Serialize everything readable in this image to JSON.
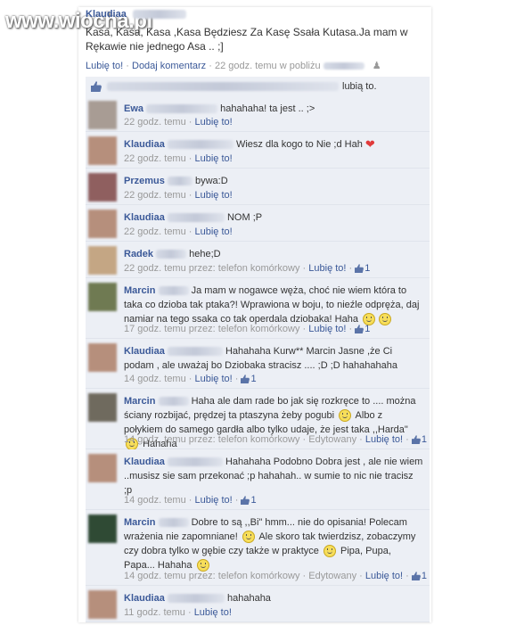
{
  "watermark": "www.wiocha.pl",
  "post": {
    "author": "Klaudiaa",
    "text": "Kasa, Kasa, Kasa ,Kasa Będziesz Za Kasę Ssała Kutasa.Ja mam w Rękawie nie jednego Asa .. ;]",
    "meta_like": "Lubię to!",
    "meta_comment": "Dodaj komentarz",
    "meta_time": "22 godz. temu w pobliżu",
    "likes_text": "lubią to."
  },
  "comments": [
    {
      "author": "Ewa",
      "text": "hahahaha! ta jest .. ;>",
      "time": "22 godz. temu",
      "like": "Lubię to!"
    },
    {
      "author": "Klaudiaa",
      "text": "Wiesz dla kogo to Nie ;d Hah",
      "time": "22 godz. temu",
      "like": "Lubię to!"
    },
    {
      "author": "Przemus",
      "text": "bywa:D",
      "time": "22 godz. temu",
      "like": "Lubię to!"
    },
    {
      "author": "Klaudiaa",
      "text": "NOM ;P",
      "time": "22 godz. temu",
      "like": "Lubię to!"
    },
    {
      "author": "Radek",
      "text": "hehe;D",
      "time": "22 godz. temu przez: telefon komórkowy",
      "like": "Lubię to!",
      "likes": "1"
    },
    {
      "author": "Marcin",
      "text": "Ja mam w nogawce węża, choć nie wiem która to taka co dzioba tak ptaka?! Wprawiona w boju, to nieźle odpręża, daj namiar na tego ssaka co tak operdala dziobaka! Haha",
      "time": "17 godz. temu przez: telefon komórkowy",
      "like": "Lubię to!",
      "likes": "1"
    },
    {
      "author": "Klaudiaa",
      "text": "Hahahaha Kurw** Marcin Jasne ,że Ci podam , ale uważaj bo Dziobaka stracisz .... ;D ;D hahahahaha",
      "time": "14 godz. temu",
      "like": "Lubię to!",
      "likes": "1"
    },
    {
      "author": "Marcin",
      "text_a": "Haha ale dam rade bo jak się rozkręce to .... można ściany rozbijać, prędzej ta ptaszyna żeby pogubi",
      "text_b": "Albo z połykiem do samego gardła albo tylko udaje, że jest taka ,,Harda\"",
      "text_c": "Hahaha",
      "time": "14 godz. temu przez: telefon komórkowy",
      "edited": "Edytowany",
      "like": "Lubię to!",
      "likes": "1"
    },
    {
      "author": "Klaudiaa",
      "text": "Hahahaha Podobno Dobra jest , ale nie wiem ..musisz sie sam przekonać ;p hahahah.. w sumie to nic nie tracisz ;p",
      "time": "14 godz. temu",
      "like": "Lubię to!",
      "likes": "1"
    },
    {
      "author": "Marcin",
      "text_a": "Dobre to są ,,Bi\" hmm... nie do opisania! Polecam wrażenia nie zapomniane!",
      "text_b": "Ale skoro tak twierdzisz, zobaczymy czy dobra tylko w gębie czy także w praktyce",
      "text_c": "Pipa, Pupa, Papa... Hahaha",
      "time": "14 godz. temu przez: telefon komórkowy",
      "edited": "Edytowany",
      "like": "Lubię to!",
      "likes": "1"
    },
    {
      "author": "Klaudiaa",
      "text": "hahahaha",
      "time": "11 godz. temu",
      "like": "Lubię to!"
    }
  ],
  "colors": {
    "link": "#3b5998",
    "meta": "#999999",
    "comment_bg": "#eceff5"
  },
  "icons": [
    "thumbs-up-icon",
    "smiley-icon",
    "heart-icon",
    "people-icon"
  ]
}
